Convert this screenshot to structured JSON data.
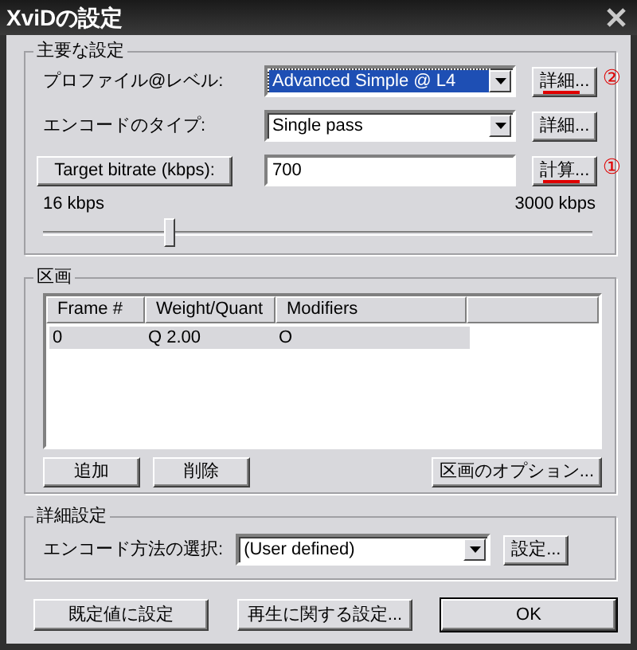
{
  "window": {
    "title": "XviDの設定"
  },
  "main_settings": {
    "title": "主要な設定",
    "rows": [
      {
        "kind": "combo",
        "label": "プロファイル@レベル:",
        "value": "Advanced Simple @ L4",
        "selected": true,
        "button": "詳細...",
        "annotation": "②"
      },
      {
        "kind": "combo",
        "label": "エンコードのタイプ:",
        "value": "Single pass",
        "selected": false,
        "button": "詳細..."
      },
      {
        "kind": "field",
        "label": "Target bitrate (kbps):",
        "value": "700",
        "button": "計算...",
        "annotation": "①"
      }
    ],
    "slider": {
      "min_label": "16 kbps",
      "max_label": "3000 kbps",
      "level": 0.23
    }
  },
  "zones": {
    "title": "区画",
    "columns": [
      "Frame #",
      "Weight/Quant",
      "Modifiers"
    ],
    "rows": [
      {
        "cells": [
          "0",
          "Q 2.00",
          "O"
        ],
        "selected": true
      }
    ],
    "buttons": [
      "追加",
      "削除",
      "区画のオプション..."
    ]
  },
  "advanced": {
    "title": "詳細設定",
    "label": "エンコード方法の選択:",
    "value": "(User defined)",
    "button": "設定..."
  },
  "buttons": [
    {
      "label": "既定値に設定",
      "default": false
    },
    {
      "label": "再生に関する設定...",
      "default": false
    },
    {
      "label": "OK",
      "default": true
    }
  ]
}
